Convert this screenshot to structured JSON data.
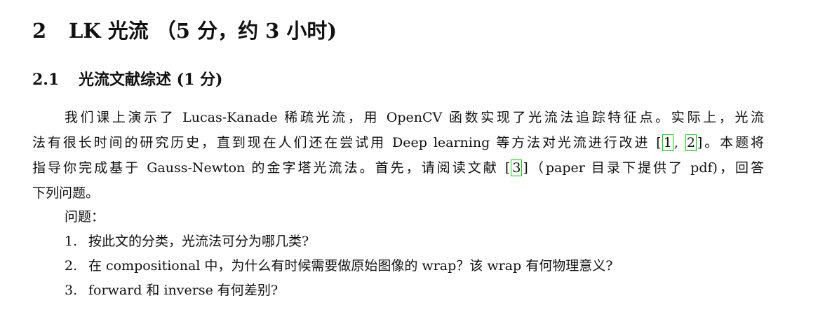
{
  "section": {
    "number": "2",
    "title": "LK 光流 （5 分，约 3 小时)"
  },
  "subsection": {
    "number": "2.1",
    "title": "光流文献综述 (1 分)"
  },
  "paragraph": {
    "line1": "我们课上演示了 Lucas-Kanade 稀疏光流，用 OpenCV 函数实现了光流法追踪特征点。实际上，光流",
    "line2_pre": "法有很长时间的研究历史，直到现在人们还在尝试用 Deep learning 等方法对光流进行改进 [",
    "cite1": "1",
    "cite_sep": ", ",
    "cite2": "2",
    "line2_post": "]。本题将",
    "line3_pre": "指导你完成基于 Gauss-Newton 的金字塔光流法。首先，请阅读文献 [",
    "cite3": "3",
    "line3_post": "]（paper 目录下提供了 pdf)，回答",
    "line4": "下列问题。"
  },
  "questions": {
    "heading": "问题：",
    "items": [
      {
        "num": "1.",
        "text": "按此文的分类，光流法可分为哪几类?"
      },
      {
        "num": "2.",
        "text": "在 compositional 中，为什么有时候需要做原始图像的 wrap？该 wrap 有何物理意义?"
      },
      {
        "num": "3.",
        "text": "forward 和 inverse 有何差别?"
      }
    ]
  },
  "colors": {
    "citation_box": "#00d000",
    "text": "#111111"
  }
}
